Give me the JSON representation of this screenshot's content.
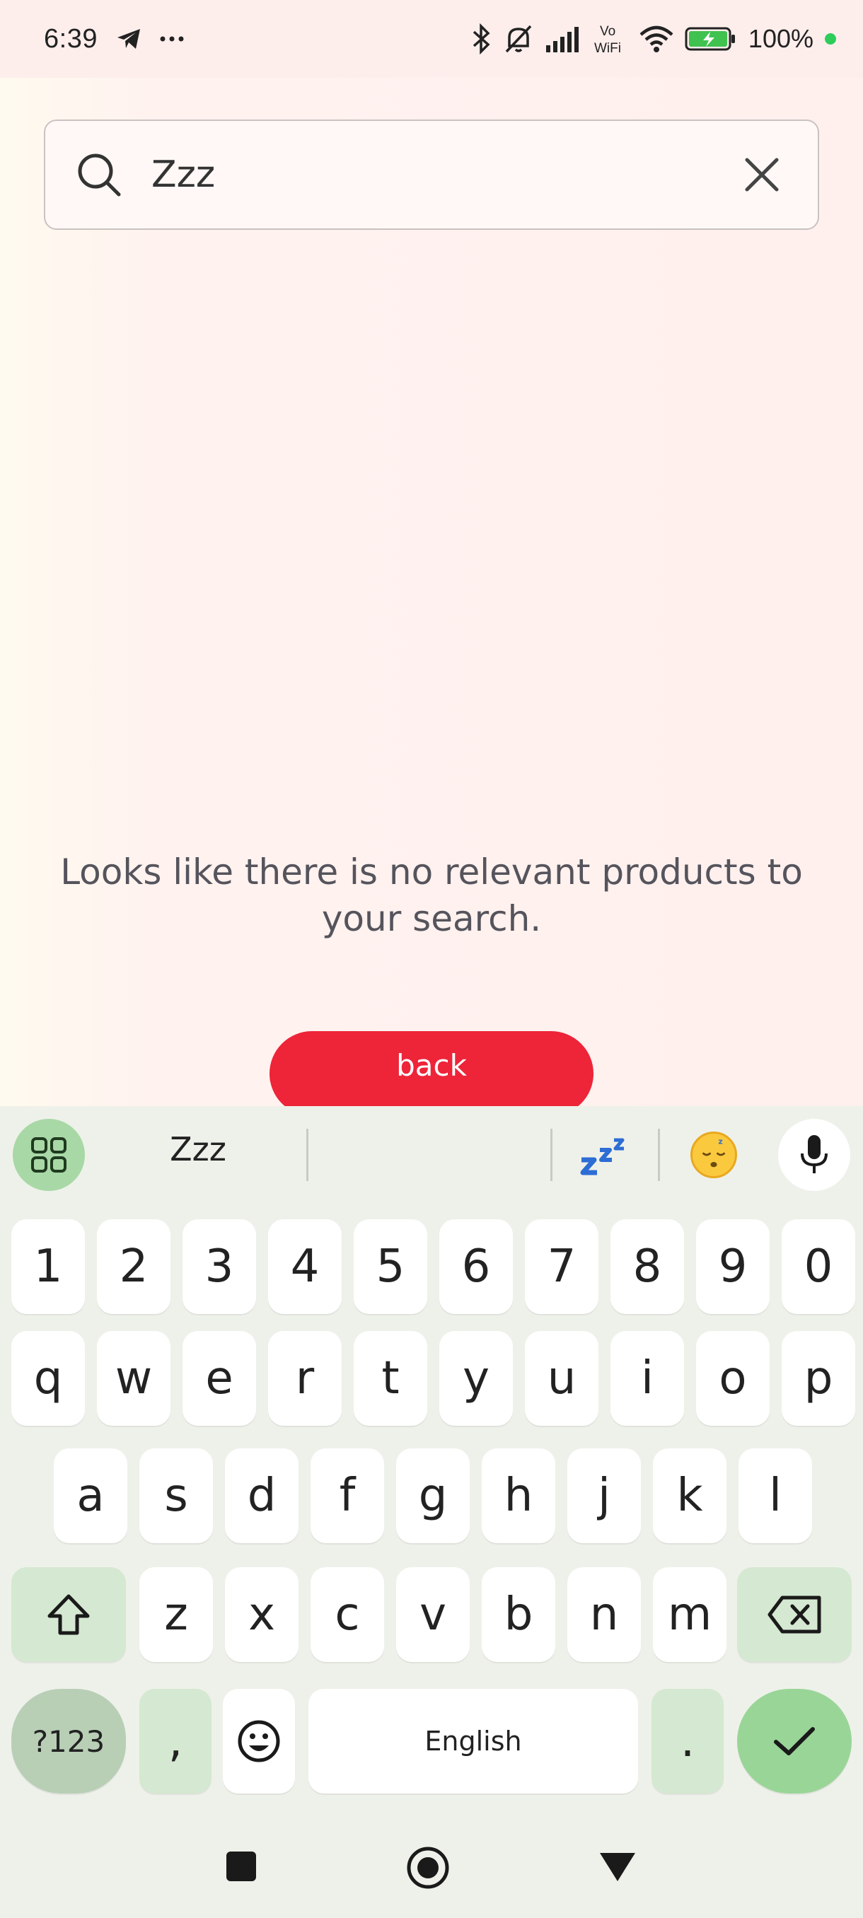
{
  "status_bar": {
    "time": "6:39",
    "battery_percent": "100%",
    "icons": [
      "telegram-icon",
      "more-icon",
      "bluetooth-icon",
      "silent-icon",
      "signal-icon",
      "vowifi-icon",
      "wifi-icon",
      "battery-icon"
    ],
    "vowifi_text": "Vo WiFi"
  },
  "search": {
    "value": "Zzz",
    "placeholder": ""
  },
  "empty_state": {
    "message": "Looks like there is no relevant products to your search."
  },
  "back_button": {
    "label": "back"
  },
  "keyboard": {
    "suggestion": "Zzz",
    "number_row": [
      "1",
      "2",
      "3",
      "4",
      "5",
      "6",
      "7",
      "8",
      "9",
      "0"
    ],
    "row1": [
      "q",
      "w",
      "e",
      "r",
      "t",
      "y",
      "u",
      "i",
      "o",
      "p"
    ],
    "row2": [
      "a",
      "s",
      "d",
      "f",
      "g",
      "h",
      "j",
      "k",
      "l"
    ],
    "row3": [
      "z",
      "x",
      "c",
      "v",
      "b",
      "n",
      "m"
    ],
    "symbols_label": "?123",
    "comma_label": ",",
    "space_label": "English",
    "period_label": ".",
    "accent_color": "#99d597"
  },
  "colors": {
    "back_button": "#ee2439",
    "caret": "#0e8a7e"
  }
}
